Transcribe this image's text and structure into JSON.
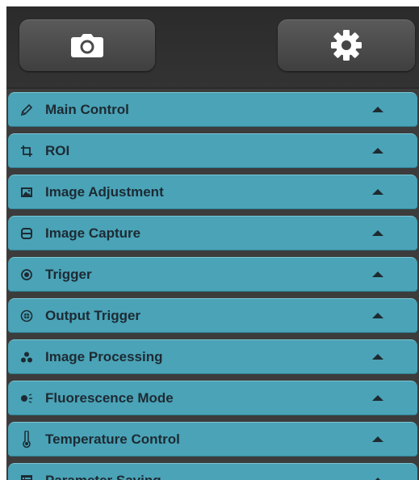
{
  "toolbar": {
    "camera_icon": "camera-icon",
    "settings_icon": "gear-icon"
  },
  "sections": [
    {
      "label": "Main Control",
      "icon": "pencil-icon"
    },
    {
      "label": "ROI",
      "icon": "crop-icon"
    },
    {
      "label": "Image Adjustment",
      "icon": "image-icon"
    },
    {
      "label": "Image Capture",
      "icon": "database-icon"
    },
    {
      "label": "Trigger",
      "icon": "record-icon"
    },
    {
      "label": "Output Trigger",
      "icon": "target-icon"
    },
    {
      "label": "Image Processing",
      "icon": "shapes-icon"
    },
    {
      "label": "Fluorescence Mode",
      "icon": "fluorescence-icon"
    },
    {
      "label": "Temperature Control",
      "icon": "thermometer-icon"
    },
    {
      "label": "Parameter Saving",
      "icon": "list-icon"
    }
  ],
  "colors": {
    "section_bg": "#4aa3b7",
    "panel_bg": "#3c3c3c",
    "label_text": "#1d2a33"
  }
}
